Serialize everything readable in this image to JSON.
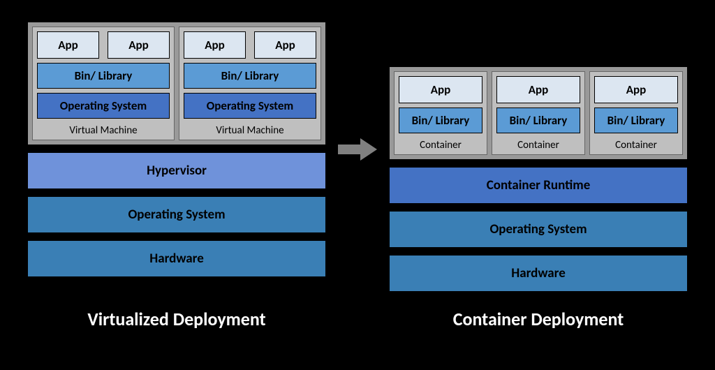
{
  "virtualized": {
    "title": "Virtualized Deployment",
    "vms": [
      {
        "apps": [
          "App",
          "App"
        ],
        "binlib": "Bin/ Library",
        "os": "Operating System",
        "label": "Virtual Machine"
      },
      {
        "apps": [
          "App",
          "App"
        ],
        "binlib": "Bin/ Library",
        "os": "Operating System",
        "label": "Virtual Machine"
      }
    ],
    "layers": {
      "hypervisor": "Hypervisor",
      "os": "Operating System",
      "hardware": "Hardware"
    }
  },
  "container": {
    "title": "Container Deployment",
    "containers": [
      {
        "app": "App",
        "binlib": "Bin/ Library",
        "label": "Container"
      },
      {
        "app": "App",
        "binlib": "Bin/ Library",
        "label": "Container"
      },
      {
        "app": "App",
        "binlib": "Bin/ Library",
        "label": "Container"
      }
    ],
    "layers": {
      "runtime": "Container Runtime",
      "os": "Operating System",
      "hardware": "Hardware"
    }
  },
  "colors": {
    "app": "#dce6f1",
    "binlib": "#5b9bd5",
    "os_inner": "#4472c4",
    "hypervisor": "#6f92da",
    "runtime": "#4472c4",
    "os_layer": "#3a7fb5",
    "hardware": "#3a7fb5",
    "group_bg": "#bfbfbf",
    "outer_bg": "#999999"
  }
}
